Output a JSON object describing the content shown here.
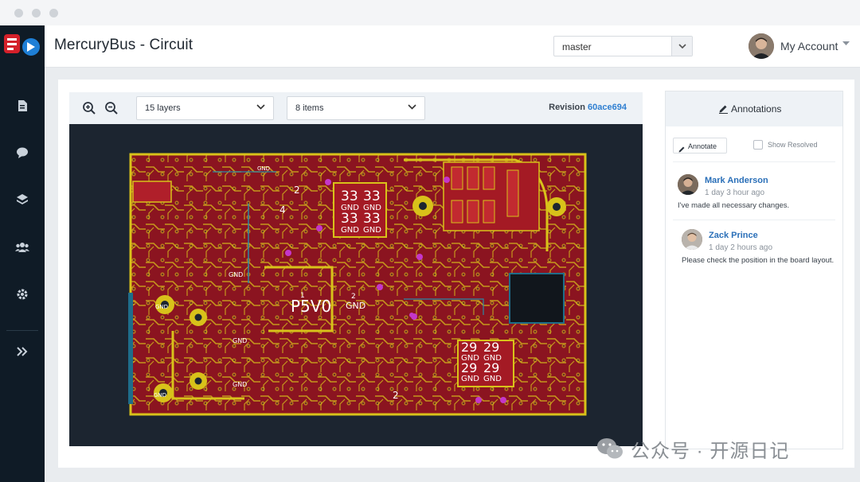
{
  "app": {
    "title": "MercuryBus - Circuit"
  },
  "sidebar": {
    "items": [
      {
        "icon": "document-icon"
      },
      {
        "icon": "chat-icon"
      },
      {
        "icon": "layers-icon"
      },
      {
        "icon": "team-icon"
      },
      {
        "icon": "gear-icon"
      },
      {
        "icon": "expand-icon"
      }
    ]
  },
  "header": {
    "branch": "master",
    "account_label": "My Account"
  },
  "toolbar": {
    "layers_select": "15 layers",
    "items_select": "8 items",
    "revision_label": "Revision",
    "revision_hash": "60ace694"
  },
  "board": {
    "labels": {
      "p5v0": "P5V0",
      "gnd": "GND",
      "two": "2",
      "one": "1",
      "four": "4",
      "thirtythree": "33",
      "twentynine": "29"
    }
  },
  "annotations": {
    "title": "Annotations",
    "annotate_button": "Annotate",
    "show_resolved": "Show Resolved",
    "comments": [
      {
        "author": "Mark Anderson",
        "time": "1 day 3 hour ago",
        "text": "I've made all necessary changes."
      },
      {
        "author": "Zack Prince",
        "time": "1 day 2 hours ago",
        "text": "Please check the position in the board layout."
      }
    ]
  },
  "watermark": {
    "text": "公众号 · 开源日记"
  },
  "colors": {
    "sidebar": "#0f1b26",
    "board_bg": "#1c2530",
    "copper": "#8b1420",
    "trace": "#d8c21a",
    "link": "#2f7fd1"
  }
}
